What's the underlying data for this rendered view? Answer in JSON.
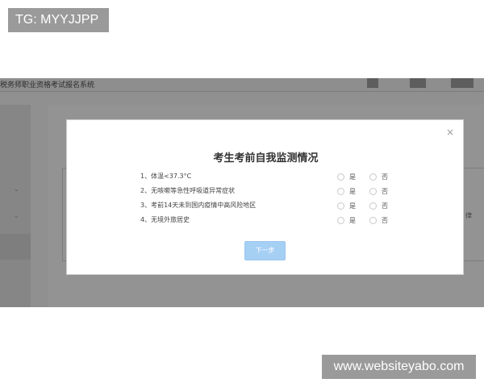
{
  "watermarks": {
    "top": "TG: MYYJJPP",
    "bottom": "www.websiteyabo.com"
  },
  "background_app": {
    "system_title": "税务师职业资格考试报名系统",
    "right_partial_text": "律"
  },
  "modal": {
    "close_icon": "close-icon",
    "title": "考生考前自我监测情况",
    "questions": [
      {
        "text": "1、体温<37.3°C",
        "yes": "是",
        "no": "否"
      },
      {
        "text": "2、无咳嗽等急性呼吸道异常症状",
        "yes": "是",
        "no": "否"
      },
      {
        "text": "3、考前14天未到国内疫情中高风险地区",
        "yes": "是",
        "no": "否"
      },
      {
        "text": "4、无境外旅居史",
        "yes": "是",
        "no": "否"
      }
    ],
    "next_button": "下一步"
  },
  "colors": {
    "overlay": "#909090",
    "button": "#a6cff4",
    "title_text": "#333333"
  }
}
